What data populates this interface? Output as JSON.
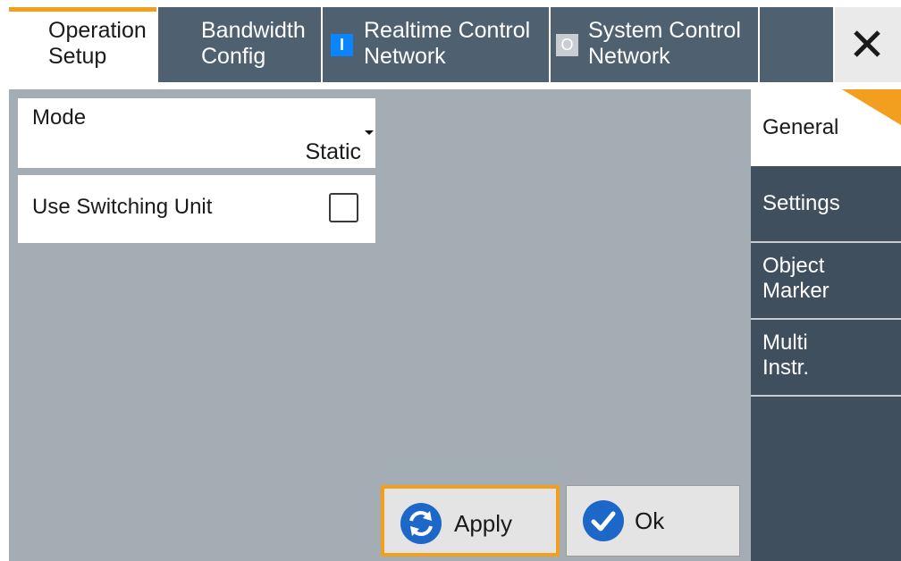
{
  "tabs": [
    {
      "line1": "Operation",
      "line2": "Setup"
    },
    {
      "line1": "Bandwidth",
      "line2": "Config"
    },
    {
      "line1": "Realtime Control",
      "line2": "Network",
      "led": "I"
    },
    {
      "line1": "System Control",
      "line2": "Network",
      "led": "O"
    }
  ],
  "close_icon": "close-icon",
  "mode": {
    "label": "Mode",
    "value": "Static"
  },
  "switching_unit": {
    "label": "Use Switching Unit",
    "checked": false
  },
  "buttons": {
    "apply": "Apply",
    "ok": "Ok"
  },
  "side_nav": [
    {
      "line1": "General",
      "line2": ""
    },
    {
      "line1": "Settings",
      "line2": ""
    },
    {
      "line1": "Object",
      "line2": "Marker"
    },
    {
      "line1": "Multi",
      "line2": "Instr."
    }
  ],
  "colors": {
    "accent": "#f29f1f",
    "tab_bg": "#4f6070",
    "panel_bg": "#a5adb4",
    "side_bg": "#3f4f5e",
    "icon_blue": "#1d67c8"
  }
}
